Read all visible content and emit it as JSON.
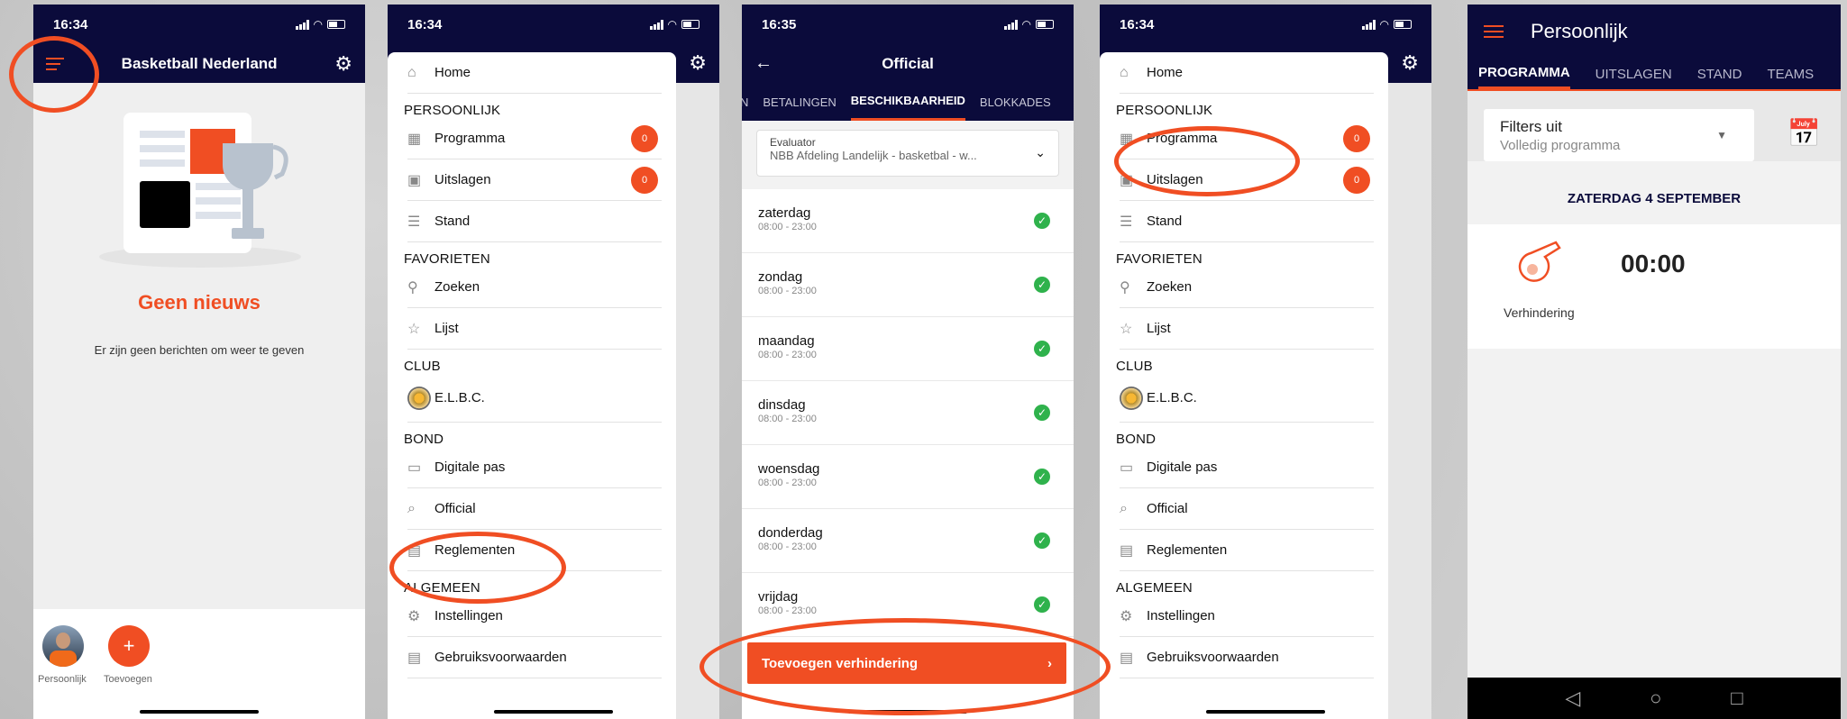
{
  "phone1": {
    "time": "16:34",
    "title": "Basketball Nederland",
    "empty_title": "Geen nieuws",
    "empty_sub": "Er zijn geen berichten om weer te geven",
    "tab_personal": "Persoonlijk",
    "tab_add": "Toevoegen",
    "add_symbol": "+"
  },
  "drawer": {
    "time": "16:34",
    "home": "Home",
    "sec_personal": "PERSOONLIJK",
    "programma": "Programma",
    "uitslagen": "Uitslagen",
    "badge": "0",
    "stand": "Stand",
    "sec_fav": "FAVORIETEN",
    "zoeken": "Zoeken",
    "lijst": "Lijst",
    "sec_club": "CLUB",
    "club": "E.L.B.C.",
    "sec_bond": "BOND",
    "pas": "Digitale pas",
    "official": "Official",
    "reglementen": "Reglementen",
    "sec_alg": "ALGEMEEN",
    "instellingen": "Instellingen",
    "gebruik": "Gebruiksvoorwaarden"
  },
  "phone3": {
    "time": "16:35",
    "title": "Official",
    "tabs": [
      "N",
      "BETALINGEN",
      "BESCHIKBAARHEID",
      "BLOKKADES"
    ],
    "select_label": "Evaluator",
    "select_value": "NBB Afdeling Landelijk - basketbal - w...",
    "days": [
      {
        "day": "zaterdag",
        "hours": "08:00 - 23:00"
      },
      {
        "day": "zondag",
        "hours": "08:00 - 23:00"
      },
      {
        "day": "maandag",
        "hours": "08:00 - 23:00"
      },
      {
        "day": "dinsdag",
        "hours": "08:00 - 23:00"
      },
      {
        "day": "woensdag",
        "hours": "08:00 - 23:00"
      },
      {
        "day": "donderdag",
        "hours": "08:00 - 23:00"
      },
      {
        "day": "vrijdag",
        "hours": "08:00 - 23:00"
      }
    ],
    "add_button": "Toevoegen verhindering",
    "add_chevron": "›"
  },
  "phone5": {
    "title": "Persoonlijk",
    "tabs": [
      "PROGRAMMA",
      "UITSLAGEN",
      "STAND",
      "TEAMS"
    ],
    "filter_main": "Filters uit",
    "filter_sub": "Volledig programma",
    "date": "ZATERDAG 4 SEPTEMBER",
    "time": "00:00",
    "item_label": "Verhindering"
  },
  "colors": {
    "navy": "#0b0b3b",
    "accent": "#f04e23",
    "success": "#2fb24c"
  }
}
